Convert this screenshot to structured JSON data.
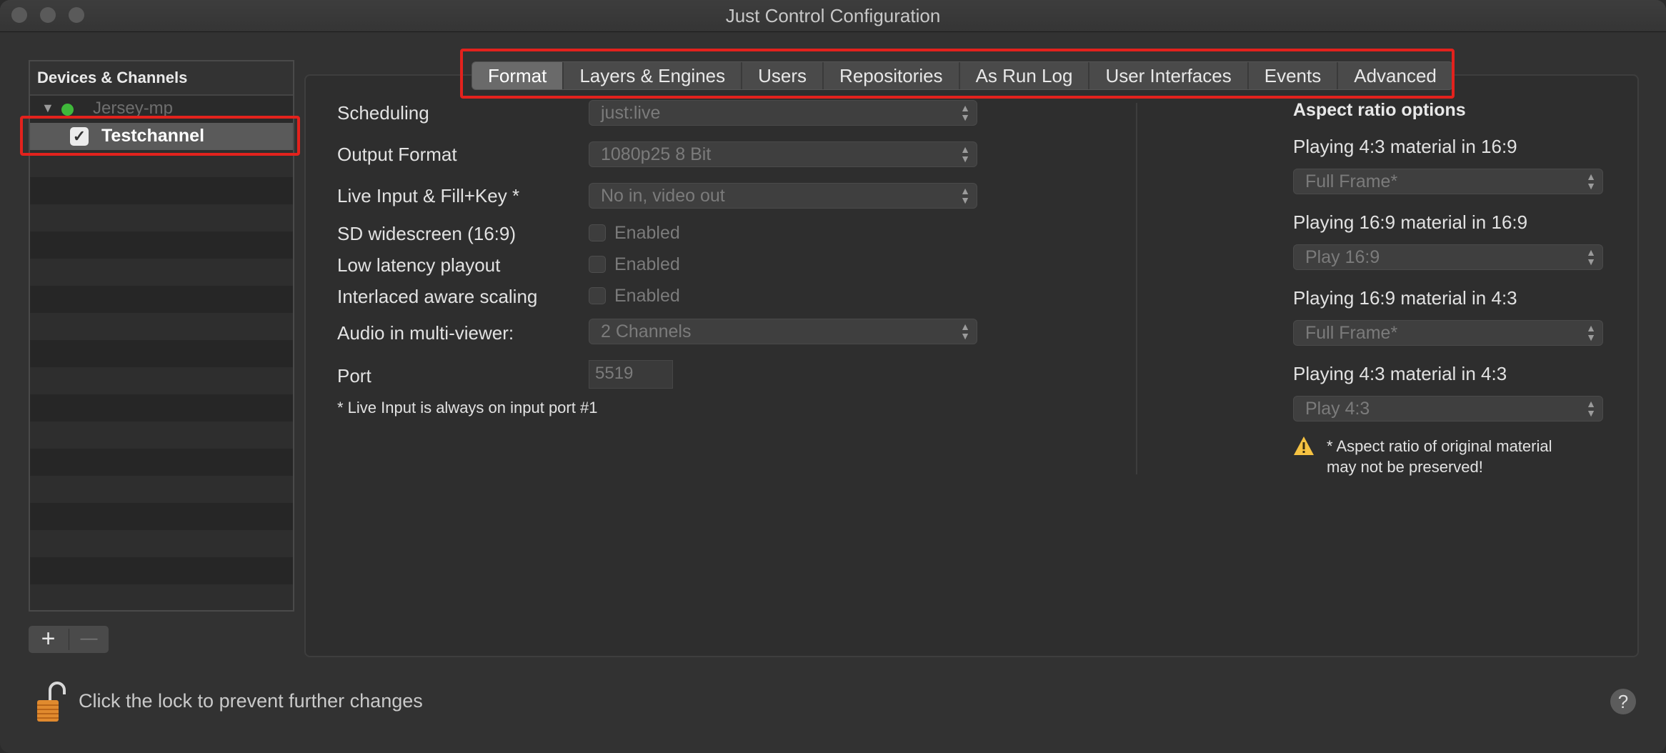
{
  "window": {
    "title": "Just Control Configuration"
  },
  "sidebar": {
    "header": "Devices & Channels",
    "device": {
      "label": "Jersey-mp",
      "status_color": "#3fb83a"
    },
    "channel": {
      "label": "Testchannel",
      "checked": true
    },
    "add_symbol": "+",
    "remove_symbol": "—"
  },
  "tabs": [
    {
      "label": "Format",
      "active": true
    },
    {
      "label": "Layers & Engines"
    },
    {
      "label": "Users"
    },
    {
      "label": "Repositories"
    },
    {
      "label": "As Run Log"
    },
    {
      "label": "User Interfaces"
    },
    {
      "label": "Events"
    },
    {
      "label": "Advanced"
    }
  ],
  "format": {
    "scheduling": {
      "label": "Scheduling",
      "value": "just:live"
    },
    "output_format": {
      "label": "Output Format",
      "value": "1080p25 8 Bit"
    },
    "live_input": {
      "label": "Live Input & Fill+Key *",
      "value": "No in, video out"
    },
    "sd_widescreen": {
      "label": "SD widescreen (16:9)",
      "checkbox": "Enabled"
    },
    "low_latency": {
      "label": "Low latency playout",
      "checkbox": "Enabled"
    },
    "interlaced": {
      "label": "Interlaced aware scaling",
      "checkbox": "Enabled"
    },
    "audio": {
      "label": "Audio in multi-viewer:",
      "value": "2 Channels"
    },
    "port": {
      "label": "Port",
      "value": "5519"
    },
    "note": "* Live Input is always on input port #1"
  },
  "aspect": {
    "title": "Aspect ratio options",
    "options": [
      {
        "label": "Playing 4:3 material in 16:9",
        "value": "Full Frame*"
      },
      {
        "label": "Playing 16:9 material in 16:9",
        "value": "Play 16:9"
      },
      {
        "label": "Playing 16:9 material in 4:3",
        "value": "Full Frame*"
      },
      {
        "label": "Playing 4:3 material in 4:3",
        "value": "Play 4:3"
      }
    ],
    "warning_line1": "* Aspect ratio of original material",
    "warning_line2": "may not be preserved!"
  },
  "footer": {
    "lock_text": "Click the lock to prevent further changes",
    "help": "?"
  },
  "colors": {
    "highlight": "#e3221d",
    "status_green": "#3fb83a",
    "warning": "#f5c242"
  }
}
